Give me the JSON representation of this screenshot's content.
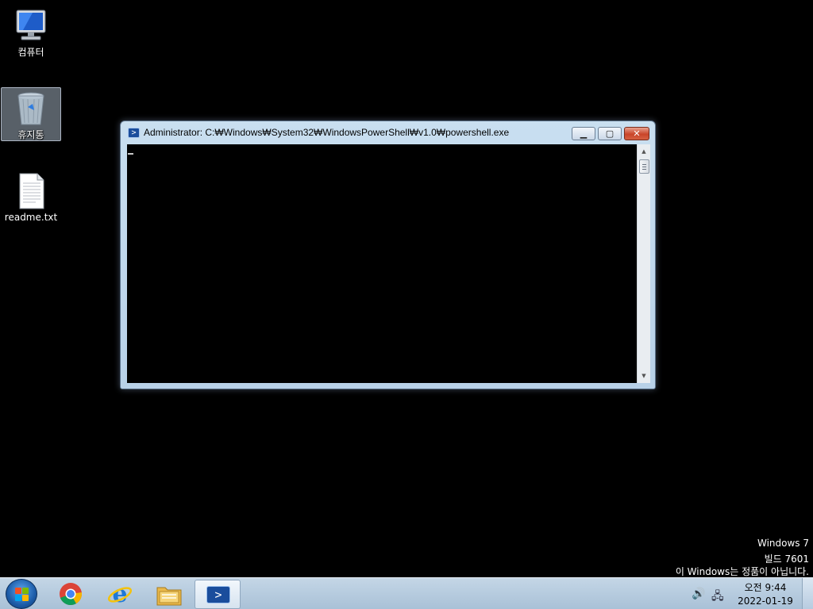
{
  "desktop": {
    "icons": [
      {
        "label": "컴퓨터"
      },
      {
        "label": "휴지통"
      },
      {
        "label": "readme.txt"
      }
    ]
  },
  "window": {
    "title": "Administrator: C:₩Windows₩System32₩WindowsPowerShell₩v1.0₩powershell.exe",
    "icon": "powershell-icon",
    "prompt_glyph": ">",
    "min_glyph": "▁",
    "max_glyph": "▢",
    "close_glyph": "✕",
    "console_bg": "#000000"
  },
  "scrollbar": {
    "up": "▲",
    "down": "▼"
  },
  "watermark": {
    "line1": "Windows 7",
    "line2": "빌드 7601",
    "line3": "이 Windows는 정품이 아닙니다."
  },
  "taskbar": {
    "apps": [
      "chrome-icon",
      "internet-explorer-icon",
      "file-explorer-icon",
      "powershell-icon"
    ],
    "active_app": "powershell",
    "tray": {
      "volume": "🔊",
      "network": "🖧"
    },
    "clock": {
      "time": "오전 9:44",
      "date": "2022-01-19"
    }
  }
}
